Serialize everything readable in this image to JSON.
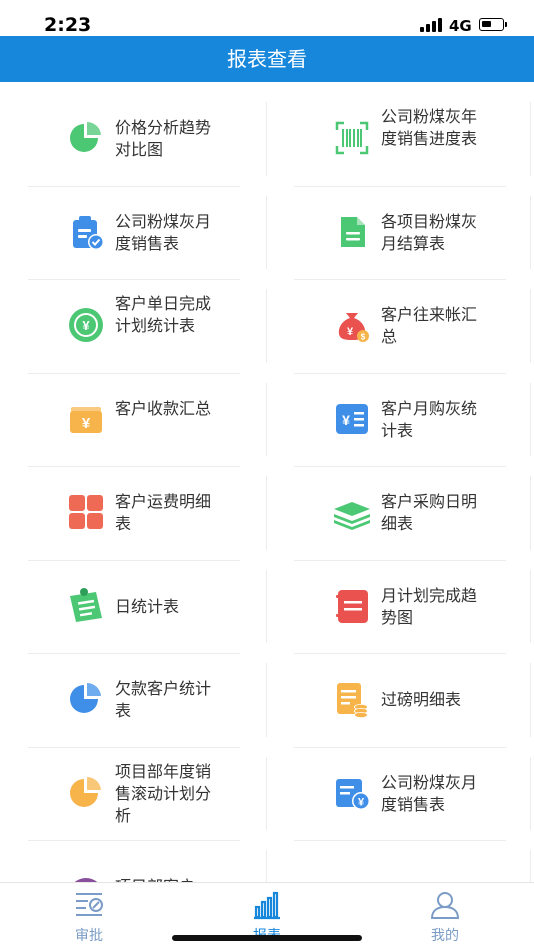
{
  "status_bar": {
    "time": "2:23",
    "network": "4G"
  },
  "header": {
    "title": "报表查看"
  },
  "reports": [
    {
      "label": "价格分析趋势对比图",
      "icon": "pie-chart-icon",
      "color": "#4cc774"
    },
    {
      "label": "公司粉煤灰年度销售进度表",
      "icon": "barcode-scan-icon",
      "color": "#4cc774"
    },
    {
      "label": "公司粉煤灰月度销售表",
      "icon": "clipboard-check-icon",
      "color": "#3f8fe9"
    },
    {
      "label": "各项目粉煤灰月结算表",
      "icon": "document-icon",
      "color": "#4cc774"
    },
    {
      "label": "客户单日完成计划统计表",
      "icon": "yuan-circle-icon",
      "color": "#4cc774"
    },
    {
      "label": "客户往来帐汇总",
      "icon": "money-bag-icon",
      "color": "#e9524f"
    },
    {
      "label": "客户收款汇总",
      "icon": "yuan-wallet-icon",
      "color": "#f6b44a"
    },
    {
      "label": "客户月购灰统计表",
      "icon": "yuan-list-icon",
      "color": "#3f8fe9"
    },
    {
      "label": "客户运费明细表",
      "icon": "grid-tiles-icon",
      "color": "#ef6a55"
    },
    {
      "label": "客户采购日明细表",
      "icon": "layers-icon",
      "color": "#4cc774"
    },
    {
      "label": "日统计表",
      "icon": "notepad-pin-icon",
      "color": "#4cc774"
    },
    {
      "label": "月计划完成趋势图",
      "icon": "notebook-icon",
      "color": "#e9524f"
    },
    {
      "label": "欠款客户统计表",
      "icon": "pie-chart-icon",
      "color": "#3f8fe9"
    },
    {
      "label": "过磅明细表",
      "icon": "document-coins-icon",
      "color": "#f6b44a"
    },
    {
      "label": "项目部年度销售滚动计划分析",
      "icon": "pie-chart-icon",
      "color": "#f6b44a"
    },
    {
      "label": "公司粉煤灰月度销售表",
      "icon": "document-yuan-icon",
      "color": "#3f8fe9"
    },
    {
      "label": "项目部客户",
      "icon": "circle-icon",
      "color": "#8a4f9c"
    }
  ],
  "tabbar": {
    "tabs": [
      {
        "label": "审批",
        "icon": "approval-list-icon",
        "active": false
      },
      {
        "label": "报表",
        "icon": "bar-chart-icon",
        "active": true
      },
      {
        "label": "我的",
        "icon": "user-icon",
        "active": false
      }
    ],
    "active_color": "#1787dc",
    "inactive_color": "#7a9cc6"
  }
}
